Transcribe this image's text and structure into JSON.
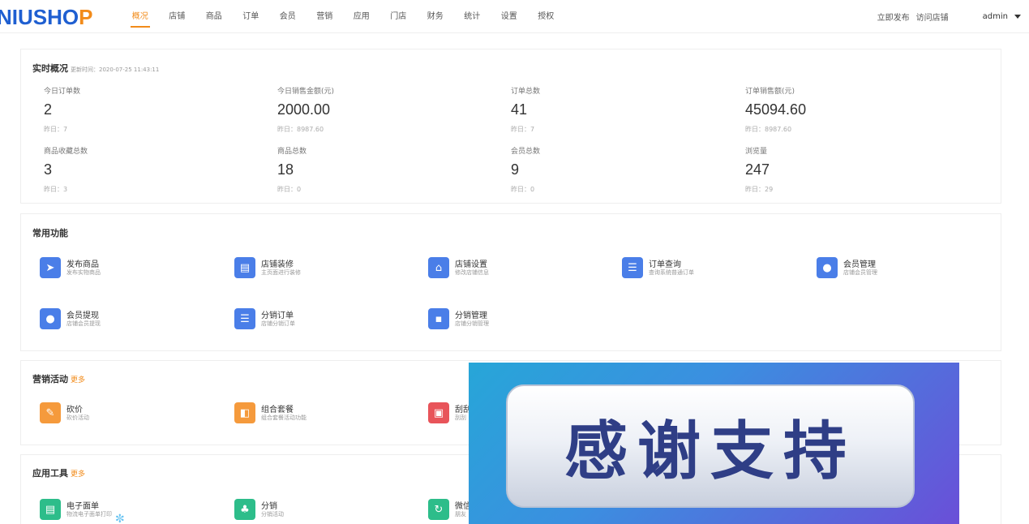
{
  "header": {
    "logo_main": "NIUSHO",
    "logo_accent": "P",
    "nav": [
      "概况",
      "店铺",
      "商品",
      "订单",
      "会员",
      "营销",
      "应用",
      "门店",
      "财务",
      "统计",
      "设置",
      "授权"
    ],
    "active_nav_index": 0,
    "right_links": [
      "立即发布",
      "访问店铺"
    ],
    "user": "admin",
    "accent_color": "#f28b1a",
    "brand_color": "#1f5fd1"
  },
  "overview": {
    "title": "实时概况",
    "updated": "更新时间：2020-07-25 11:43:11",
    "stats": [
      {
        "label": "今日订单数",
        "value": "2",
        "yesterday": "昨日：7"
      },
      {
        "label": "今日销售金额(元)",
        "value": "2000.00",
        "yesterday": "昨日：8987.60"
      },
      {
        "label": "订单总数",
        "value": "41",
        "yesterday": "昨日：7"
      },
      {
        "label": "订单销售额(元)",
        "value": "45094.60",
        "yesterday": "昨日：8987.60"
      },
      {
        "label": "商品收藏总数",
        "value": "3",
        "yesterday": "昨日：3"
      },
      {
        "label": "商品总数",
        "value": "18",
        "yesterday": "昨日：0"
      },
      {
        "label": "会员总数",
        "value": "9",
        "yesterday": "昨日：0"
      },
      {
        "label": "浏览量",
        "value": "247",
        "yesterday": "昨日：29"
      }
    ]
  },
  "common": {
    "title": "常用功能",
    "items": [
      {
        "name": "发布商品",
        "desc": "发布实物商品",
        "icon": "send-icon",
        "color": "#4a7ee8"
      },
      {
        "name": "店铺装修",
        "desc": "主页面进行装修",
        "icon": "document-icon",
        "color": "#4a7ee8"
      },
      {
        "name": "店铺设置",
        "desc": "修改店铺信息",
        "icon": "shop-icon",
        "color": "#4a7ee8"
      },
      {
        "name": "订单查询",
        "desc": "查询系统普通订单",
        "icon": "order-icon",
        "color": "#4a7ee8"
      },
      {
        "name": "会员管理",
        "desc": "店铺会员管理",
        "icon": "member-icon",
        "color": "#4a7ee8"
      },
      {
        "name": "会员提现",
        "desc": "店铺会员提现",
        "icon": "withdraw-icon",
        "color": "#4a7ee8"
      },
      {
        "name": "分销订单",
        "desc": "店铺分销订单",
        "icon": "list-icon",
        "color": "#4a7ee8"
      },
      {
        "name": "分销管理",
        "desc": "店铺分销管理",
        "icon": "distribution-icon",
        "color": "#4a7ee8"
      }
    ]
  },
  "marketing": {
    "title": "营销活动",
    "more": "更多",
    "items": [
      {
        "name": "砍价",
        "desc": "砍价活动",
        "icon": "bargain-icon",
        "color": "#f59a3c"
      },
      {
        "name": "组合套餐",
        "desc": "组合套餐活动功能",
        "icon": "combo-icon",
        "color": "#f59a3c"
      },
      {
        "name": "刮刮",
        "desc": "刮刮",
        "icon": "scratch-icon",
        "color": "#e8545a"
      }
    ]
  },
  "tools": {
    "title": "应用工具",
    "more": "更多",
    "items": [
      {
        "name": "电子面单",
        "desc": "物流电子面单打印",
        "icon": "waybill-icon",
        "color": "#2dbd8a"
      },
      {
        "name": "分销",
        "desc": "分销活动",
        "icon": "fenxiao-icon",
        "color": "#2dbd8a"
      },
      {
        "name": "微信",
        "desc": "朋友",
        "icon": "refresh-icon",
        "color": "#2dbd8a"
      }
    ]
  },
  "banner": {
    "text": "感谢支持"
  }
}
